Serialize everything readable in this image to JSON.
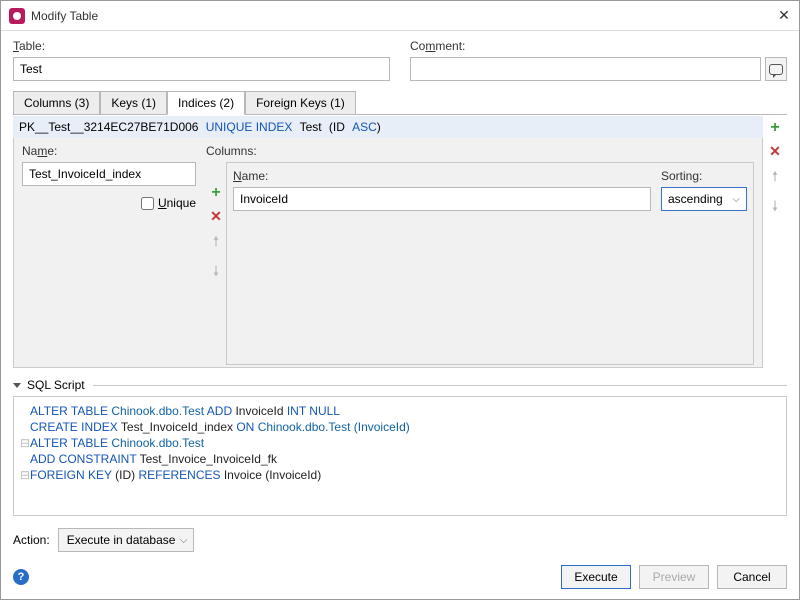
{
  "window": {
    "title": "Modify Table"
  },
  "labels": {
    "table": "Table:",
    "comment": "Comment:",
    "name": "Name:",
    "columns": "Columns:",
    "col_name": "Name:",
    "sorting": "Sorting:",
    "unique": "Unique",
    "sql_script": "SQL Script",
    "action": "Action:"
  },
  "fields": {
    "table": "Test",
    "comment": "",
    "index_name": "Test_InvoiceId_index",
    "col_name": "InvoiceId",
    "sorting": "ascending",
    "unique_checked": false
  },
  "tabs": [
    {
      "label": "Columns (3)"
    },
    {
      "label": "Keys (1)"
    },
    {
      "label": "Indices (2)",
      "active": true
    },
    {
      "label": "Foreign Keys (1)"
    }
  ],
  "index_def": {
    "pk_name": "PK__Test__3214EC27BE71D006",
    "type": "UNIQUE INDEX",
    "tbl": "Test",
    "cols_open": "(",
    "col": "ID",
    "dir": "ASC",
    "cols_close": ")"
  },
  "sql": {
    "l1a": "ALTER TABLE",
    "l1b": "Chinook.dbo.Test",
    "l1c": "ADD",
    "l1d": "InvoiceId",
    "l1e": "INT NULL",
    "l2a": "CREATE INDEX",
    "l2b": "Test_InvoiceId_index",
    "l2c": "ON",
    "l2d": "Chinook.dbo.Test (InvoiceId)",
    "l3a": "ALTER TABLE",
    "l3b": "Chinook.dbo.Test",
    "l4a": "ADD CONSTRAINT",
    "l4b": "Test_Invoice_InvoiceId_fk",
    "l5a": "FOREIGN KEY",
    "l5b": "(ID)",
    "l5c": "REFERENCES",
    "l5d": "Invoice (InvoiceId)"
  },
  "action_mode": "Execute in database",
  "buttons": {
    "execute": "Execute",
    "preview": "Preview",
    "cancel": "Cancel"
  }
}
